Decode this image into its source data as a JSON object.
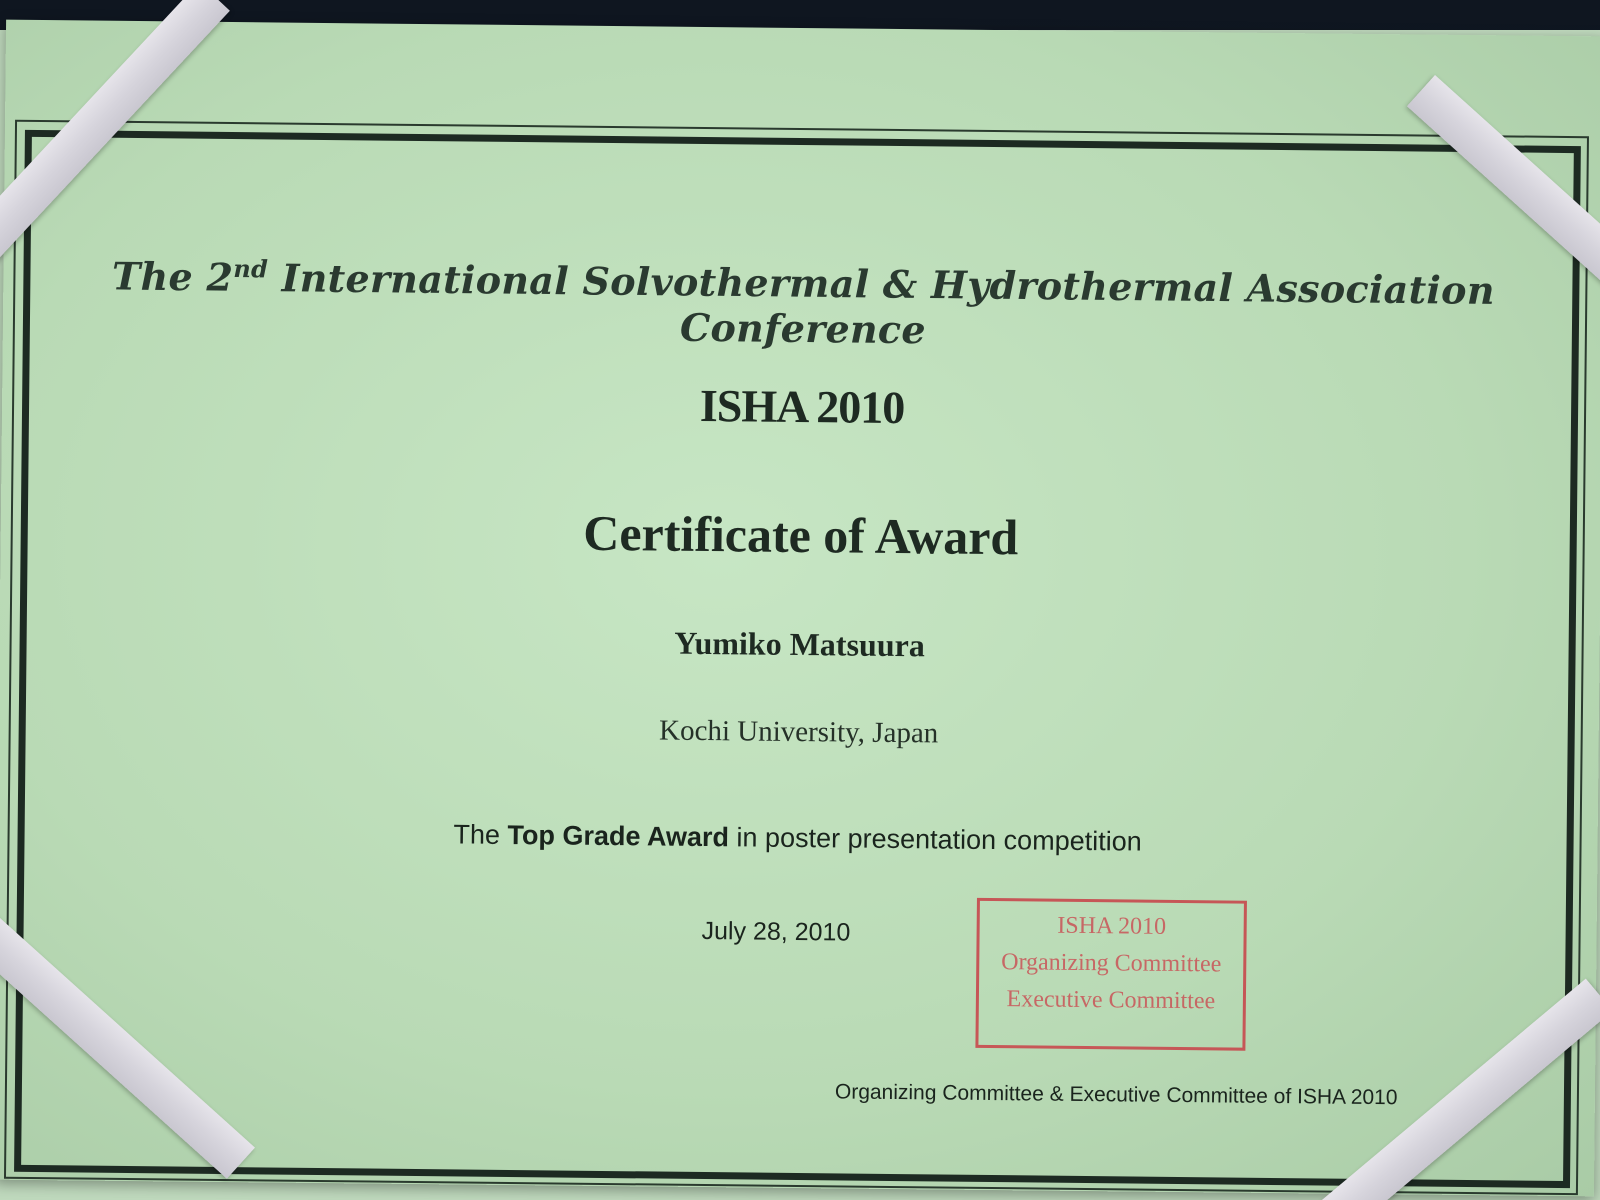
{
  "certificate": {
    "conference_title_prefix": "The 2",
    "conference_title_sup": "nd",
    "conference_title_rest": " International Solvothermal & Hydrothermal Association Conference",
    "event": "ISHA 2010",
    "heading": "Certificate of Award",
    "recipient": "Yumiko Matsuura",
    "affiliation": "Kochi University, Japan",
    "award_prefix": "The ",
    "award_name": "Top Grade Award",
    "award_suffix": " in poster presentation competition",
    "date": "July 28, 2010",
    "issuer": "Organizing Committee & Executive Committee of ISHA 2010"
  },
  "stamp": {
    "lines": [
      "ISHA 2010",
      "Organizing Committee",
      "Executive Committee"
    ],
    "color": "#c8444a"
  },
  "colors": {
    "paper": "#c3e2bf",
    "border": "#1d2a22",
    "ribbon": "#dcdae2"
  }
}
